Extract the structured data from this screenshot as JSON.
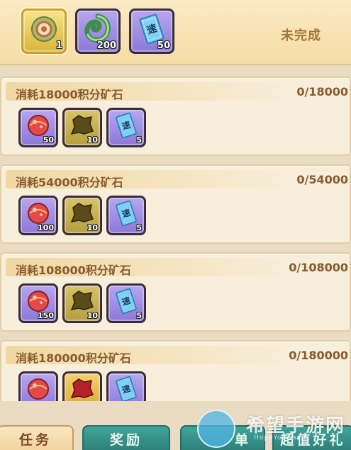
{
  "top": {
    "status": "未完成",
    "rewards": [
      {
        "icon": "ring-disc-icon",
        "qty": "1"
      },
      {
        "icon": "green-jade-icon",
        "qty": "200"
      },
      {
        "icon": "speed-ticket-icon",
        "qty": "50"
      }
    ]
  },
  "tasks": [
    {
      "title": "消耗18000积分矿石",
      "progress": "0/18000",
      "rewards": [
        {
          "icon": "red-orb-icon",
          "qty": "50"
        },
        {
          "icon": "ore-shard-icon",
          "qty": "10"
        },
        {
          "icon": "speed-ticket-icon",
          "qty": "5"
        }
      ]
    },
    {
      "title": "消耗54000积分矿石",
      "progress": "0/54000",
      "rewards": [
        {
          "icon": "red-orb-icon",
          "qty": "100"
        },
        {
          "icon": "ore-shard-icon",
          "qty": "10"
        },
        {
          "icon": "speed-ticket-icon",
          "qty": "5"
        }
      ]
    },
    {
      "title": "消耗108000积分矿石",
      "progress": "0/108000",
      "rewards": [
        {
          "icon": "red-orb-icon",
          "qty": "150"
        },
        {
          "icon": "ore-shard-icon",
          "qty": "10"
        },
        {
          "icon": "speed-ticket-icon",
          "qty": "5"
        }
      ]
    },
    {
      "title": "消耗180000积分矿石",
      "progress": "0/180000",
      "rewards": [
        {
          "icon": "red-orb-icon",
          "qty": ""
        },
        {
          "icon": "red-ore-shard-icon",
          "qty": ""
        },
        {
          "icon": "speed-ticket-icon",
          "qty": ""
        }
      ]
    }
  ],
  "tabs": [
    {
      "label": "任务",
      "active": true
    },
    {
      "label": "奖励",
      "active": false
    },
    {
      "label": "单",
      "active": false
    },
    {
      "label": "超值好礼",
      "active": false
    }
  ],
  "ticket_glyph": "速",
  "watermark": {
    "title": "希望手游网",
    "sub": "HopeYouGame"
  },
  "colors": {
    "title_text": "#8a5a2c",
    "status_text": "#a8743a",
    "tab_teal": "#2d7f78",
    "tile_purple": "#8c78d8"
  }
}
